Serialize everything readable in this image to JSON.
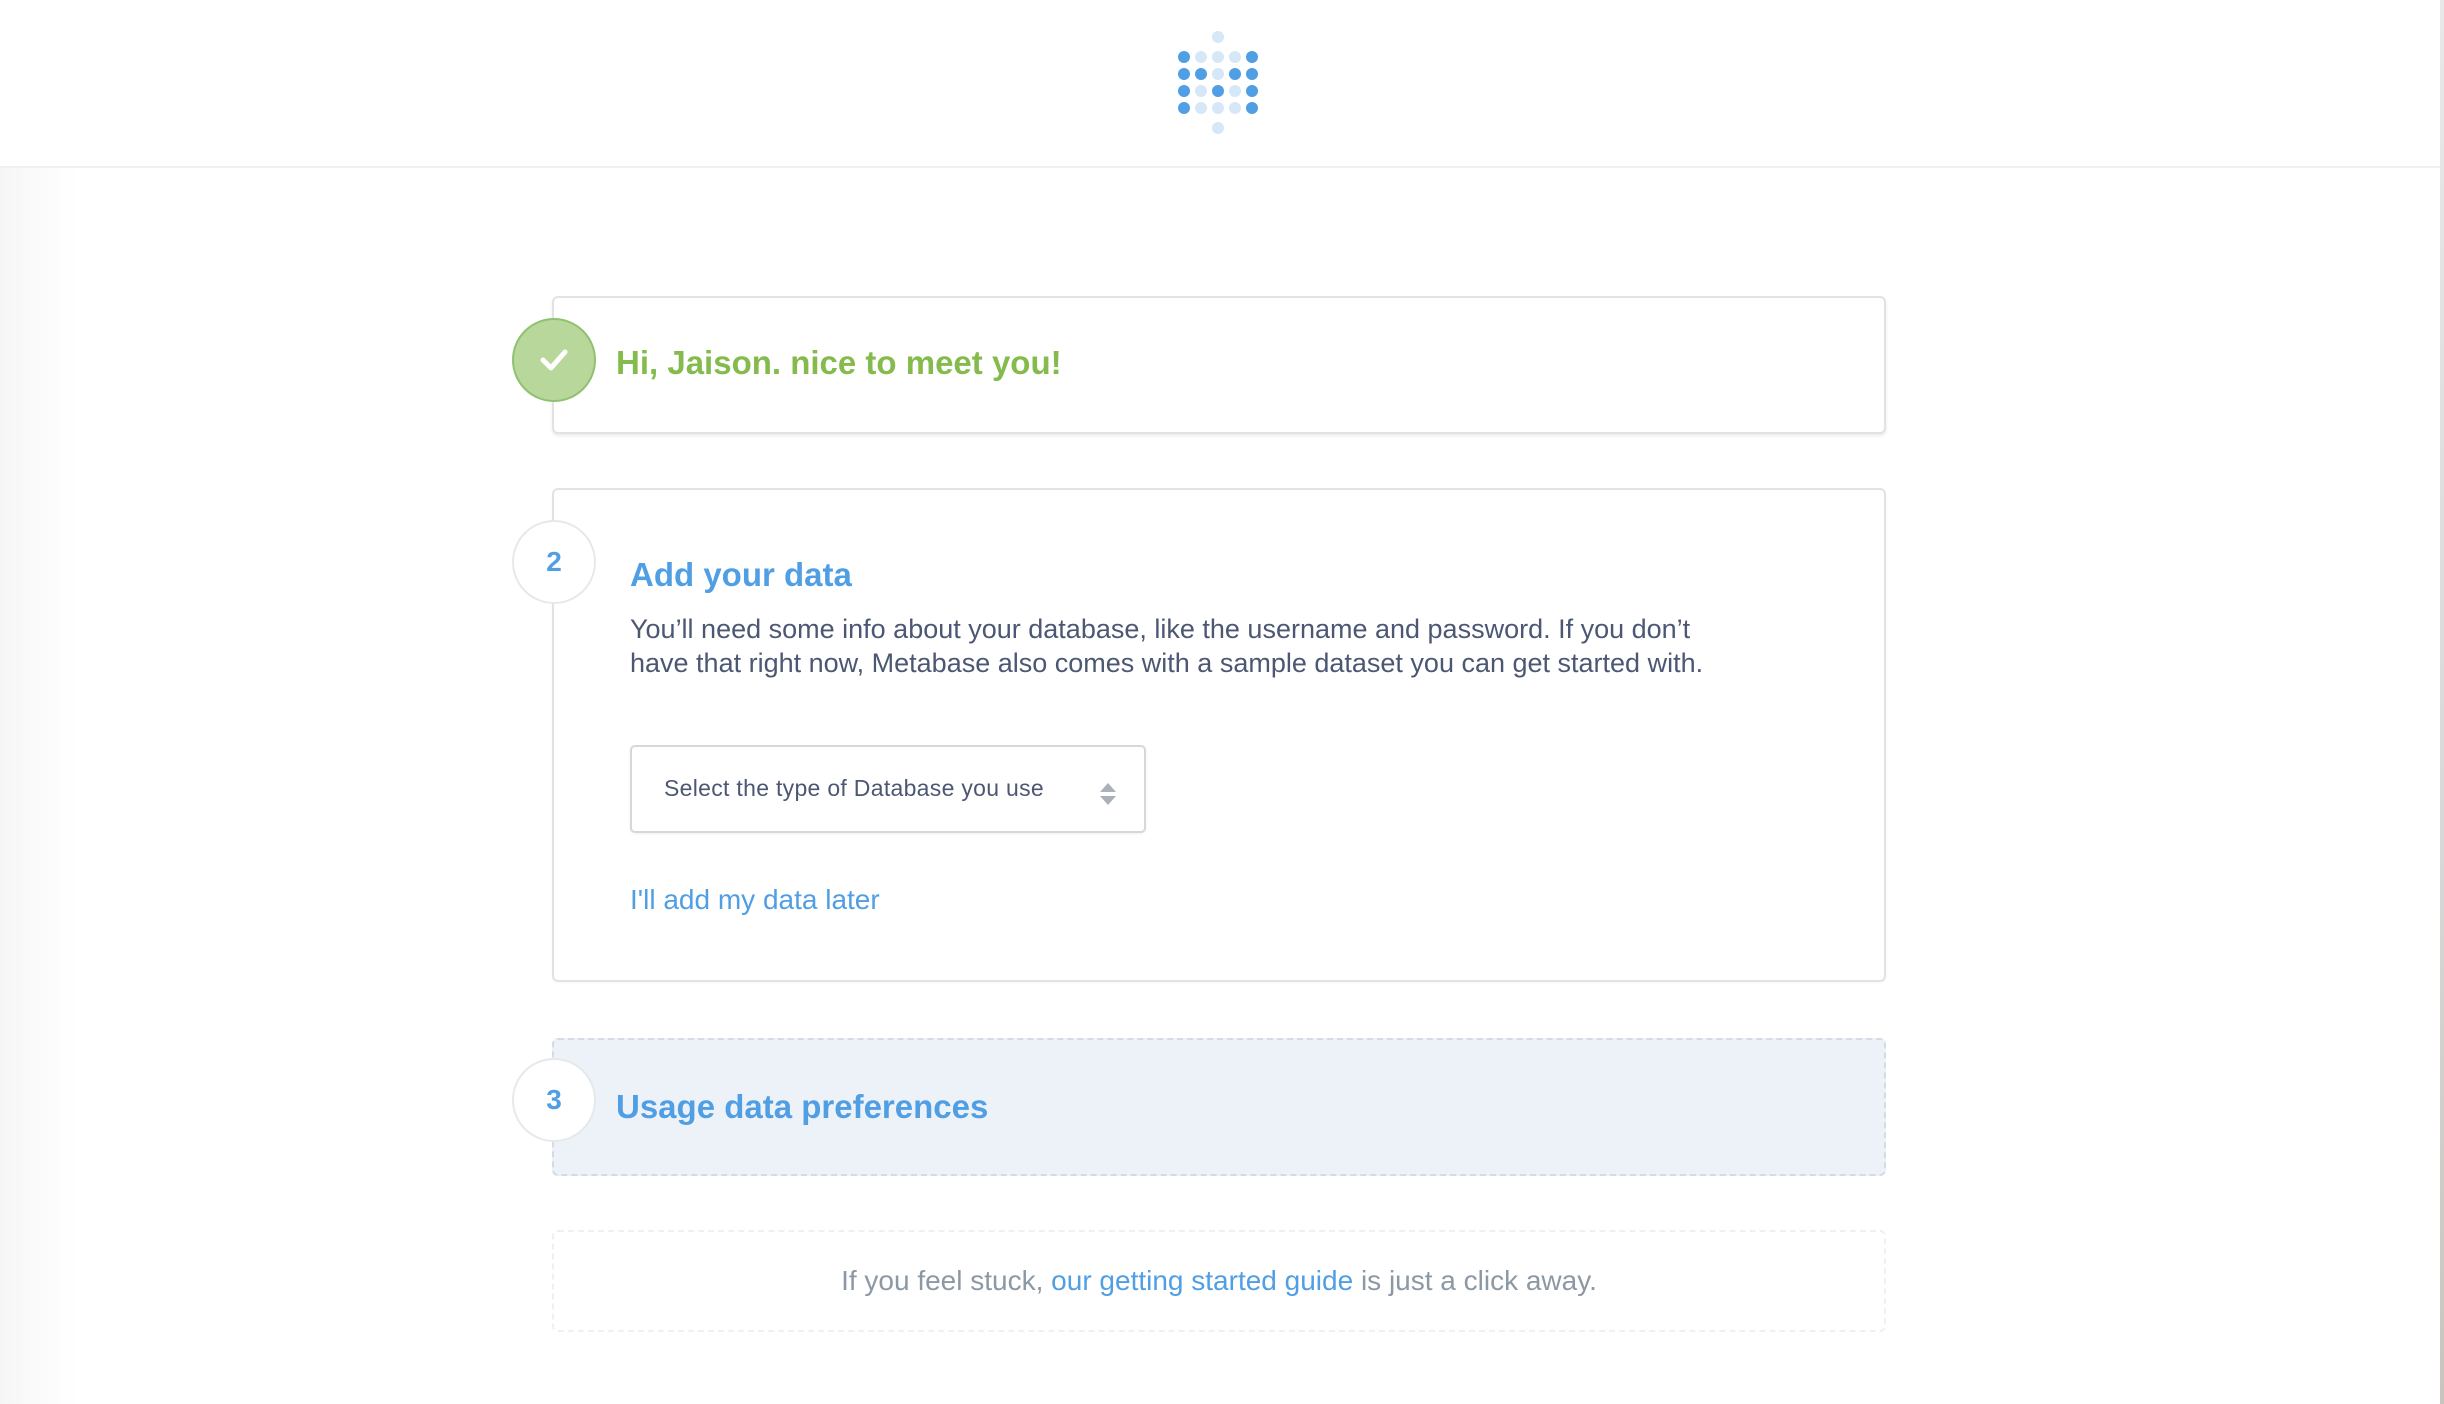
{
  "header": {
    "logo_icon": "metabase-logo-icon"
  },
  "steps": {
    "step1": {
      "icon": "check-icon",
      "title": "Hi, Jaison. nice to meet you!"
    },
    "step2": {
      "number": "2",
      "title": "Add your data",
      "description": "You’ll need some info about your database, like the username and password. If you don’t have that right now, Metabase also comes with a sample dataset you can get started with.",
      "select_placeholder": "Select the type of Database you use",
      "later_link": "I'll add my data later"
    },
    "step3": {
      "number": "3",
      "title": "Usage data preferences"
    }
  },
  "help": {
    "prefix": "If you feel stuck,",
    "link": "our getting started guide",
    "suffix": "is just a click away."
  },
  "colors": {
    "brand_blue": "#509ee3",
    "success_green": "#84bb4c",
    "text_dark": "#4c5773",
    "text_muted": "#8c98a4",
    "inactive_bg": "#edf2f8"
  }
}
